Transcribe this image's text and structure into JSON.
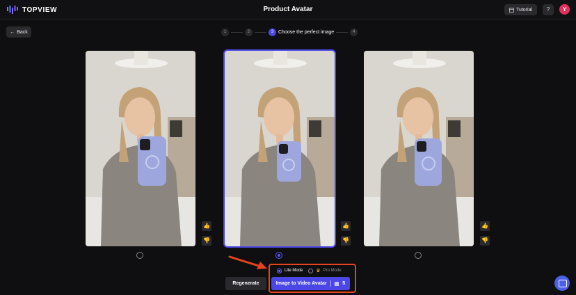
{
  "header": {
    "logo_text": "TOPVIEW",
    "title": "Product Avatar",
    "tutorial_label": "Tutorial",
    "help_label": "?",
    "avatar_letter": "Y"
  },
  "back_label": "Back",
  "stepper": {
    "steps": [
      "1",
      "2",
      "3",
      "4"
    ],
    "active_step": 3,
    "active_label": "Choose the perfect image"
  },
  "cards": [
    {
      "selected": false
    },
    {
      "selected": true
    },
    {
      "selected": false
    }
  ],
  "mode": {
    "lite_label": "Lite Mode",
    "pro_label": "Pro Mode",
    "selected": "Lite Mode"
  },
  "actions": {
    "regenerate_label": "Regenerate",
    "i2v_label": "Image to Video Avatar",
    "credits": "5"
  },
  "icons": {
    "thumb_up": "thumbs-up-icon",
    "thumb_down": "thumbs-down-icon",
    "chat": "chat-icon"
  },
  "colors": {
    "accent": "#4b47e6",
    "annotation": "#e8431c",
    "avatar": "#e7305f"
  }
}
